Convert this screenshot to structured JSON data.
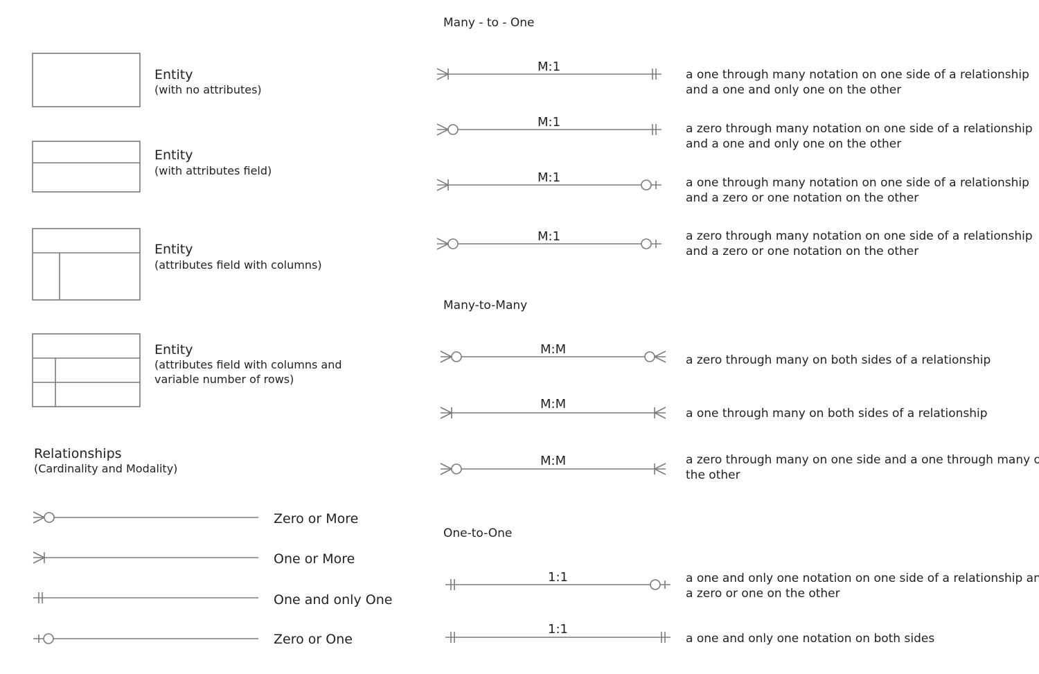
{
  "entities": [
    {
      "title": "Entity",
      "subtitle": "(with no attributes)"
    },
    {
      "title": "Entity",
      "subtitle": "(with attributes field)"
    },
    {
      "title": "Entity",
      "subtitle": "(attributes field with columns)"
    },
    {
      "title": "Entity",
      "subtitle": "(attributes field with columns and",
      "subtitle2": "variable number of rows)"
    }
  ],
  "relationships": {
    "title": "Relationships",
    "subtitle": "(Cardinality and Modality)",
    "items": [
      {
        "label": "Zero or More",
        "symbol": "zero-or-more"
      },
      {
        "label": "One or More",
        "symbol": "one-or-more"
      },
      {
        "label": "One and only One",
        "symbol": "one-and-only-one"
      },
      {
        "label": "Zero or One",
        "symbol": "zero-or-one"
      }
    ]
  },
  "sections": [
    {
      "title": "Many - to - One",
      "rows": [
        {
          "card": "M:1",
          "left": "one-or-more",
          "right": "one-and-only-one",
          "desc1": "a one through many notation on one side of a relationship",
          "desc2": "and a one and only one on the other"
        },
        {
          "card": "M:1",
          "left": "zero-or-more",
          "right": "one-and-only-one",
          "desc1": "a zero through many notation on one side of a relationship",
          "desc2": "and a one and only one on the other"
        },
        {
          "card": "M:1",
          "left": "one-or-more",
          "right": "zero-or-one",
          "desc1": "a one through many notation on one side of a relationship",
          "desc2": "and a zero or one notation on the other"
        },
        {
          "card": "M:1",
          "left": "zero-or-more",
          "right": "zero-or-one",
          "desc1": "a zero through many notation on one side of a relationship",
          "desc2": "and a zero or one notation on the other"
        }
      ]
    },
    {
      "title": "Many-to-Many",
      "rows": [
        {
          "card": "M:M",
          "left": "zero-or-more",
          "right": "zero-or-more",
          "desc1": "a zero through many on both sides of a relationship",
          "desc2": ""
        },
        {
          "card": "M:M",
          "left": "one-or-more",
          "right": "one-or-more",
          "desc1": "a one through many on both sides of a relationship",
          "desc2": ""
        },
        {
          "card": "M:M",
          "left": "zero-or-more",
          "right": "one-or-more",
          "desc1": "a zero through many on one side and a one through many on",
          "desc2": "the other"
        }
      ]
    },
    {
      "title": "One-to-One",
      "rows": [
        {
          "card": "1:1",
          "left": "one-and-only-one",
          "right": "zero-or-one",
          "desc1": "a one and only one notation on one side of a relationship and",
          "desc2": "a zero or one on the other"
        },
        {
          "card": "1:1",
          "left": "one-and-only-one",
          "right": "one-and-only-one",
          "desc1": "a one and only one notation on both sides",
          "desc2": ""
        }
      ]
    }
  ],
  "colors": {
    "stroke": "#7a7a7a",
    "text": "#222222"
  }
}
